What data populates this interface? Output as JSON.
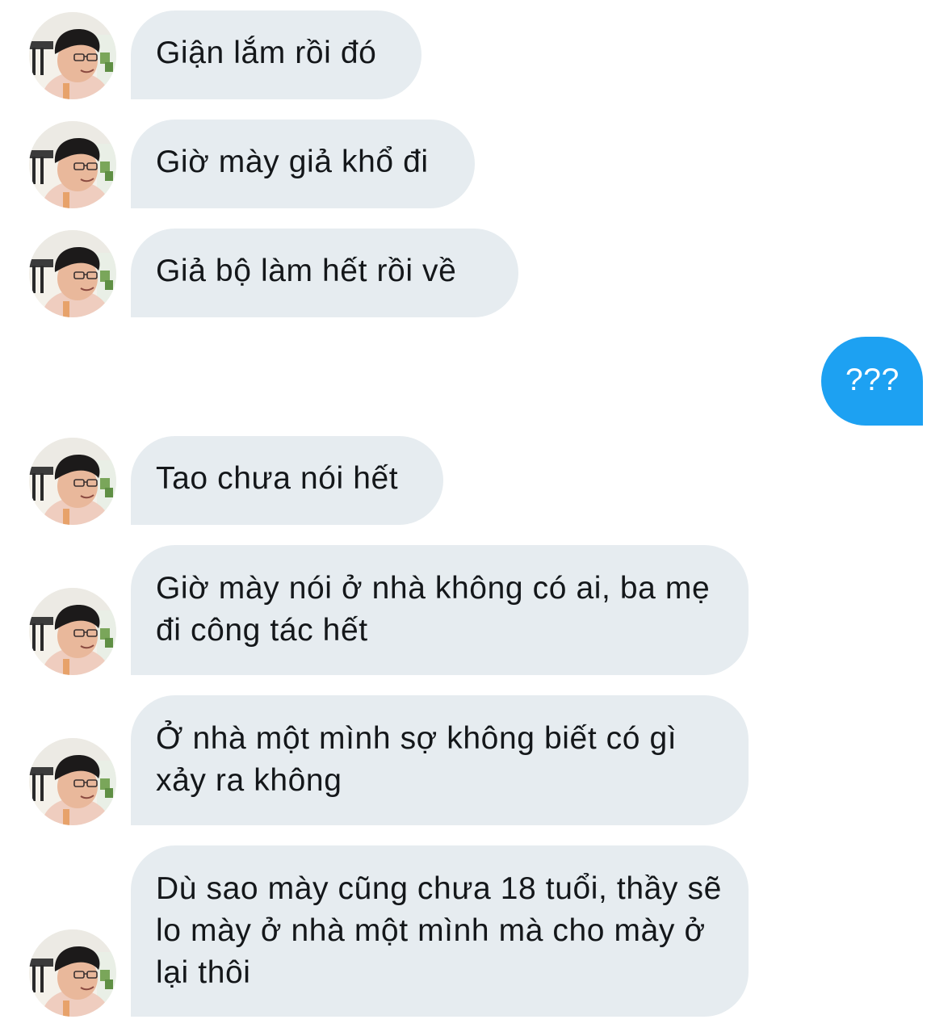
{
  "conversation": {
    "messages": [
      {
        "sender": "other",
        "text": "Giận lắm rồi đó"
      },
      {
        "sender": "other",
        "text": "Giờ mày giả khổ đi"
      },
      {
        "sender": "other",
        "text": "Giả bộ làm hết rồi về"
      },
      {
        "sender": "me",
        "text": "???"
      },
      {
        "sender": "other",
        "text": "Tao chưa nói hết"
      },
      {
        "sender": "other",
        "text": "Giờ mày nói ở nhà không có ai, ba mẹ đi công tác hết"
      },
      {
        "sender": "other",
        "text": "Ở nhà một mình sợ không biết có gì xảy ra không"
      },
      {
        "sender": "other",
        "text": "Dù sao mày cũng chưa 18 tuổi, thầy sẽ lo mày ở nhà một mình mà cho mày ở lại thôi"
      }
    ]
  },
  "theme": {
    "incoming_bubble_color": "#e6ecf0",
    "outgoing_bubble_color": "#1da1f2",
    "incoming_text_color": "#14171a",
    "outgoing_text_color": "#ffffff"
  },
  "icons": {
    "avatar": "user-avatar-photo"
  }
}
